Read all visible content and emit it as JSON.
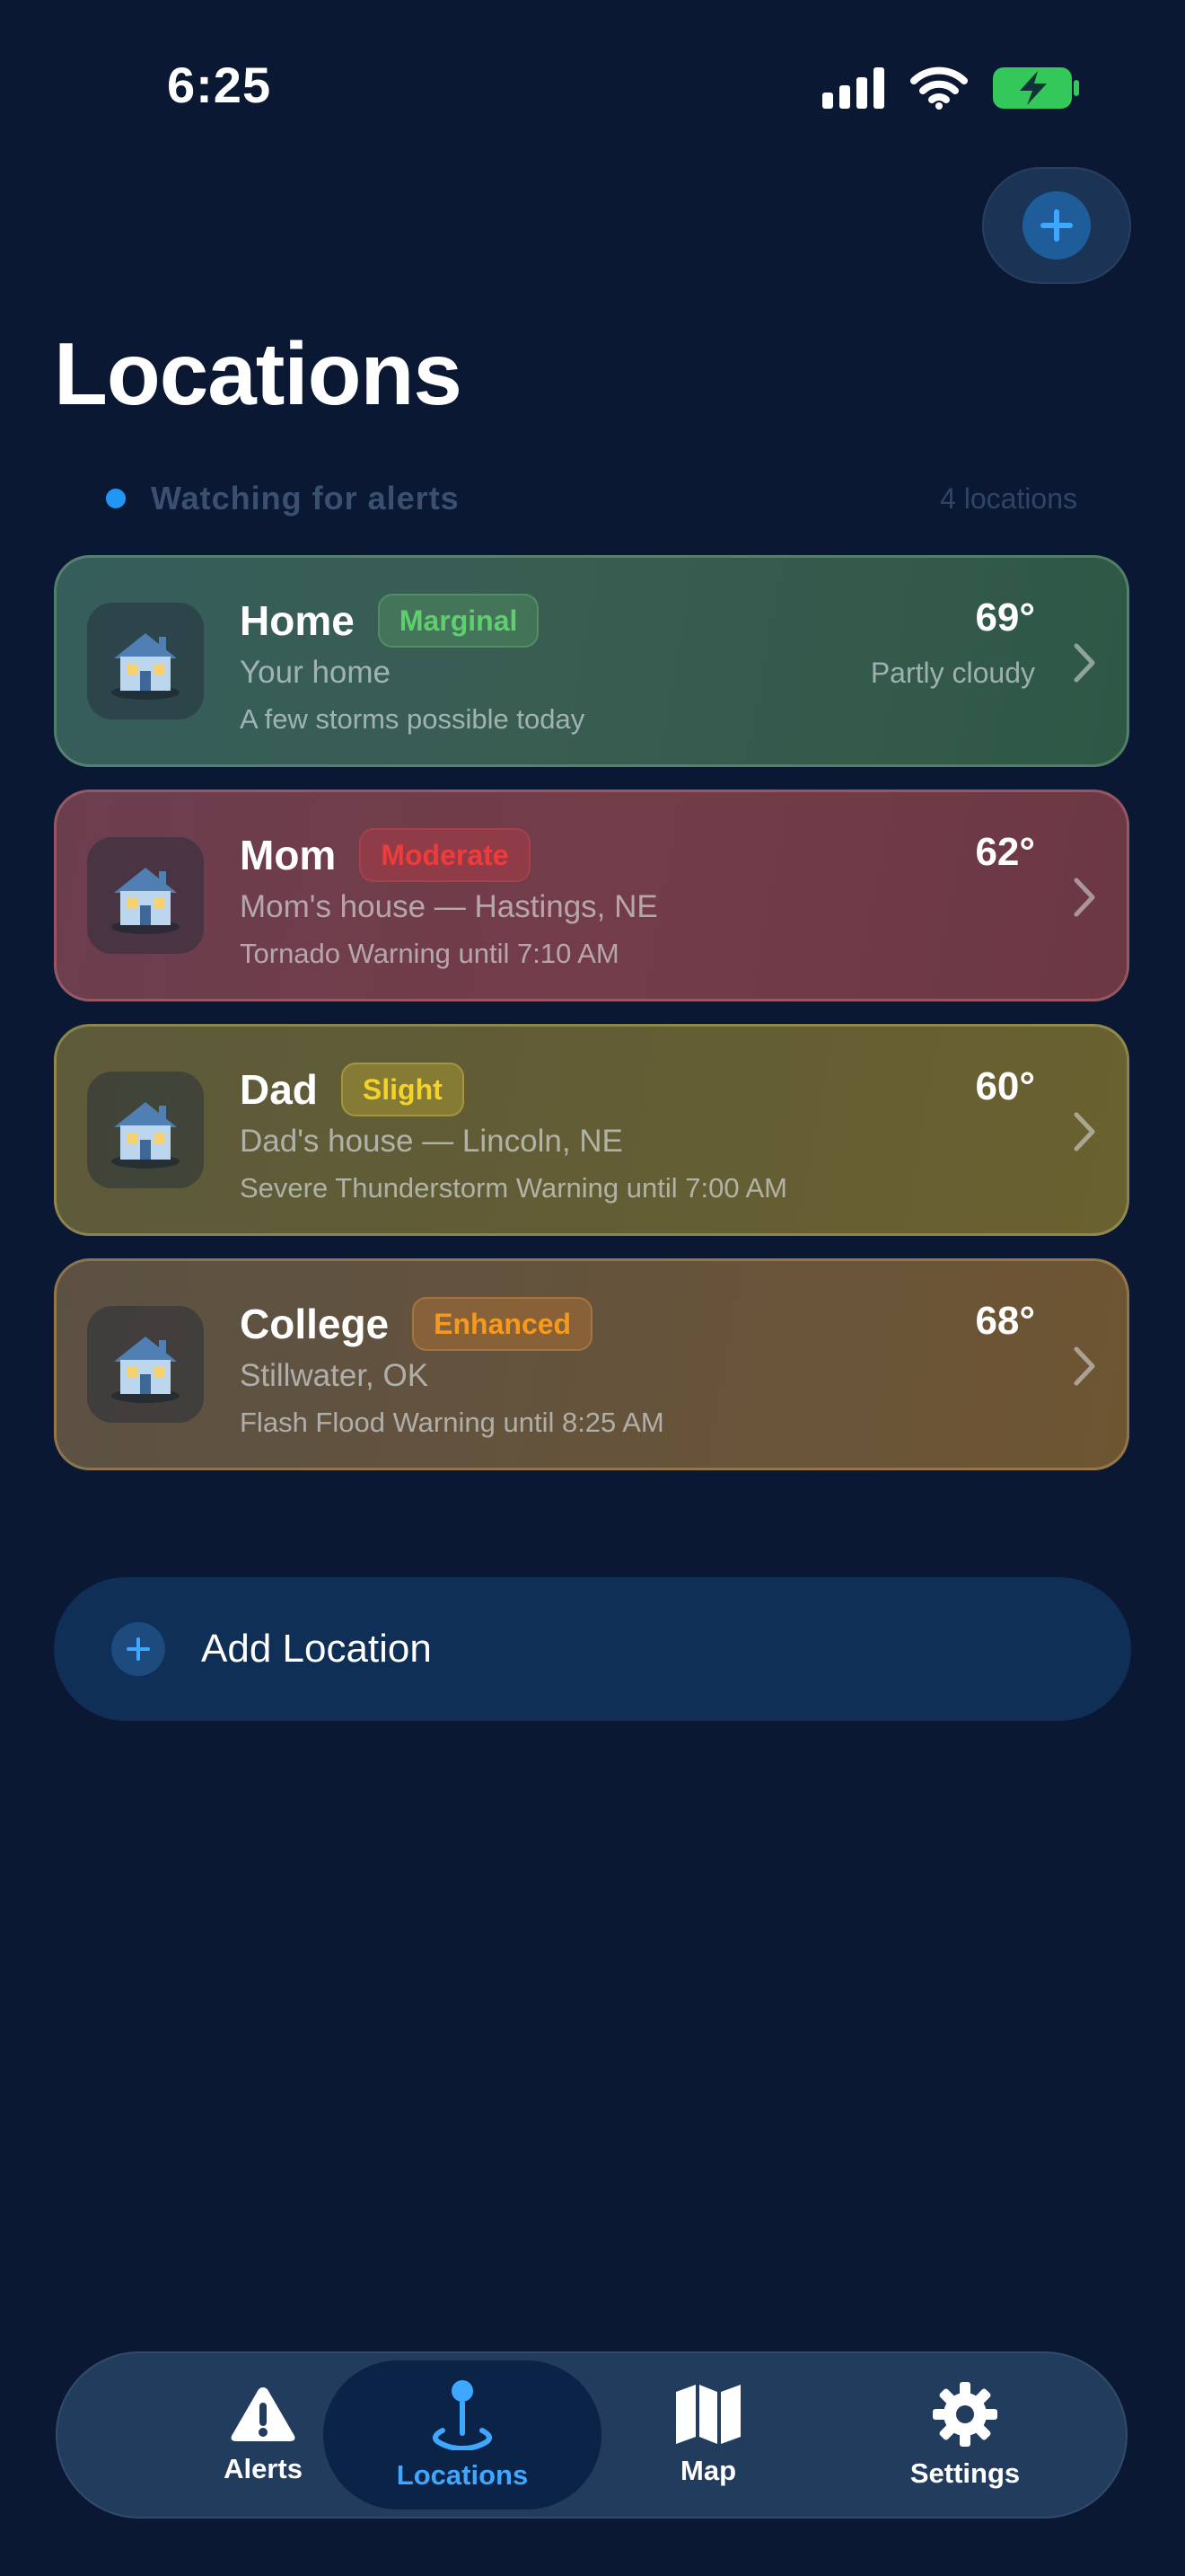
{
  "status_bar": {
    "time": "6:25"
  },
  "header": {
    "title": "Locations"
  },
  "watch": {
    "text": "Watching for alerts",
    "count": "4 locations"
  },
  "locations": [
    {
      "name": "Home",
      "risk": "Marginal",
      "subtitle": "Your home",
      "detail": "A few storms possible today",
      "temp": "69°",
      "condition": "Partly cloudy"
    },
    {
      "name": "Mom",
      "risk": "Moderate",
      "subtitle": "Mom's house — Hastings, NE",
      "detail": "Tornado Warning until 7:10 AM",
      "temp": "62°",
      "condition": ""
    },
    {
      "name": "Dad",
      "risk": "Slight",
      "subtitle": "Dad's house — Lincoln, NE",
      "detail": "Severe Thunderstorm Warning until 7:00 AM",
      "temp": "60°",
      "condition": ""
    },
    {
      "name": "College",
      "risk": "Enhanced",
      "subtitle": "Stillwater, OK",
      "detail": "Flash Flood Warning until 8:25 AM",
      "temp": "68°",
      "condition": ""
    }
  ],
  "add_location": {
    "label": "Add Location"
  },
  "tabs": [
    {
      "label": "Alerts",
      "icon": "warning-icon",
      "active": false
    },
    {
      "label": "Locations",
      "icon": "location-pin-icon",
      "active": true
    },
    {
      "label": "Map",
      "icon": "map-icon",
      "active": false
    },
    {
      "label": "Settings",
      "icon": "gear-icon",
      "active": false
    }
  ],
  "colors": {
    "background": "#0a1833",
    "accent": "#3ea7ff",
    "marginal": "#5fcf6e",
    "moderate": "#ef3b3b",
    "slight": "#f5d22a",
    "enhanced": "#f59a1e"
  }
}
